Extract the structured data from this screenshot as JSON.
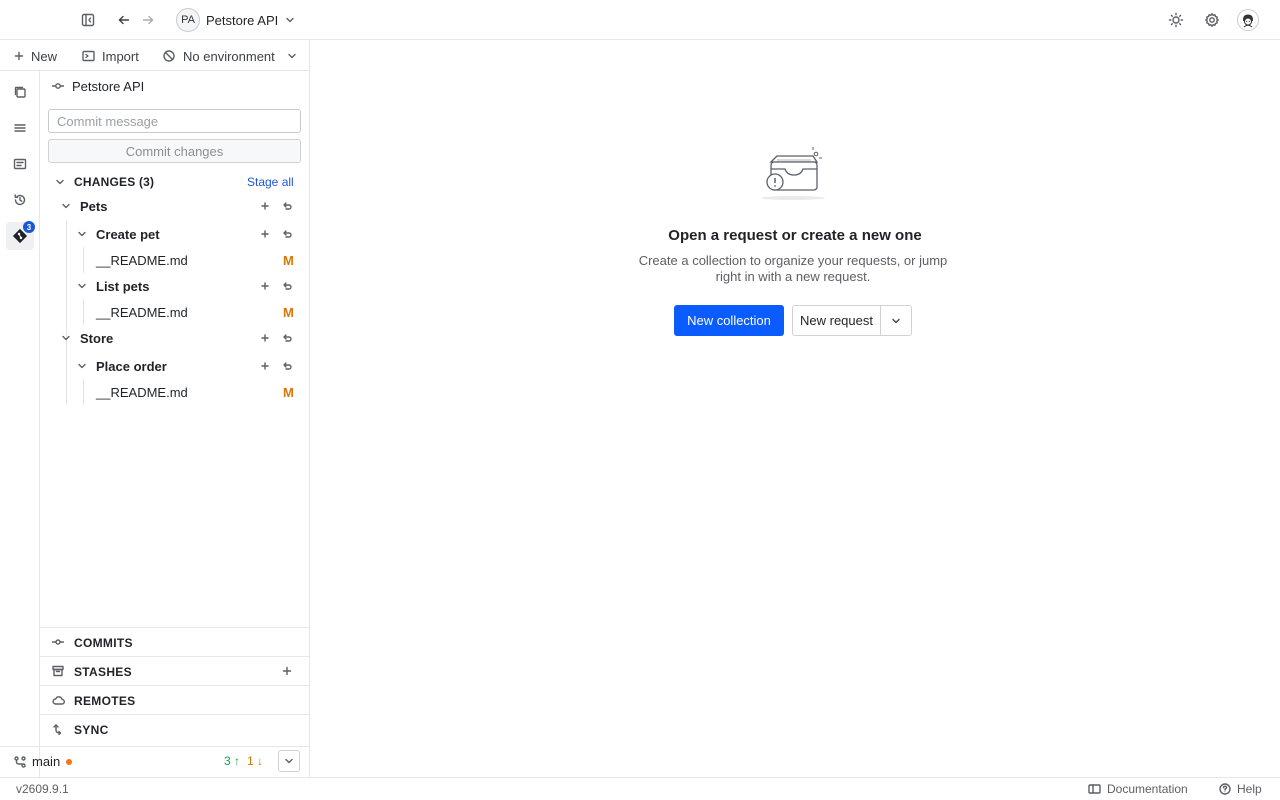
{
  "header": {
    "workspace_initials": "PA",
    "workspace_name": "Petstore API",
    "icons": [
      "sidebar-toggle-icon",
      "back-arrow-icon",
      "forward-arrow-icon",
      "chevron-down-icon",
      "sun-icon",
      "gear-icon",
      "user-avatar-icon"
    ]
  },
  "actions": {
    "new_label": "New",
    "import_label": "Import",
    "environment_label": "No environment"
  },
  "activity_bar": {
    "git_badge": "3"
  },
  "git_panel": {
    "repo_name": "Petstore API",
    "commit_placeholder": "Commit message",
    "commit_button": "Commit changes",
    "changes_label": "CHANGES (3)",
    "stage_all": "Stage all",
    "tree": [
      {
        "label": "Pets"
      },
      {
        "label": "Create pet"
      },
      {
        "label": "__README.md",
        "status": "M"
      },
      {
        "label": "List pets"
      },
      {
        "label": "__README.md",
        "status": "M"
      },
      {
        "label": "Store"
      },
      {
        "label": "Place order"
      },
      {
        "label": "__README.md",
        "status": "M"
      }
    ],
    "sections": {
      "commits": "COMMITS",
      "stashes": "STASHES",
      "remotes": "REMOTES",
      "sync": "SYNC"
    },
    "branch": {
      "name": "main",
      "ahead": "3 ↑",
      "behind": "1 ↓"
    }
  },
  "main": {
    "empty_title": "Open a request or create a new one",
    "empty_description": "Create a collection to organize your requests, or jump right in with a new request.",
    "new_collection": "New collection",
    "new_request": "New request"
  },
  "status_bar": {
    "version": "v2609.9.1",
    "documentation": "Documentation",
    "help": "Help"
  },
  "colors": {
    "primary": "#0b5cff",
    "link": "#1a56db",
    "modified": "#d97706",
    "ahead": "#16a34a"
  }
}
